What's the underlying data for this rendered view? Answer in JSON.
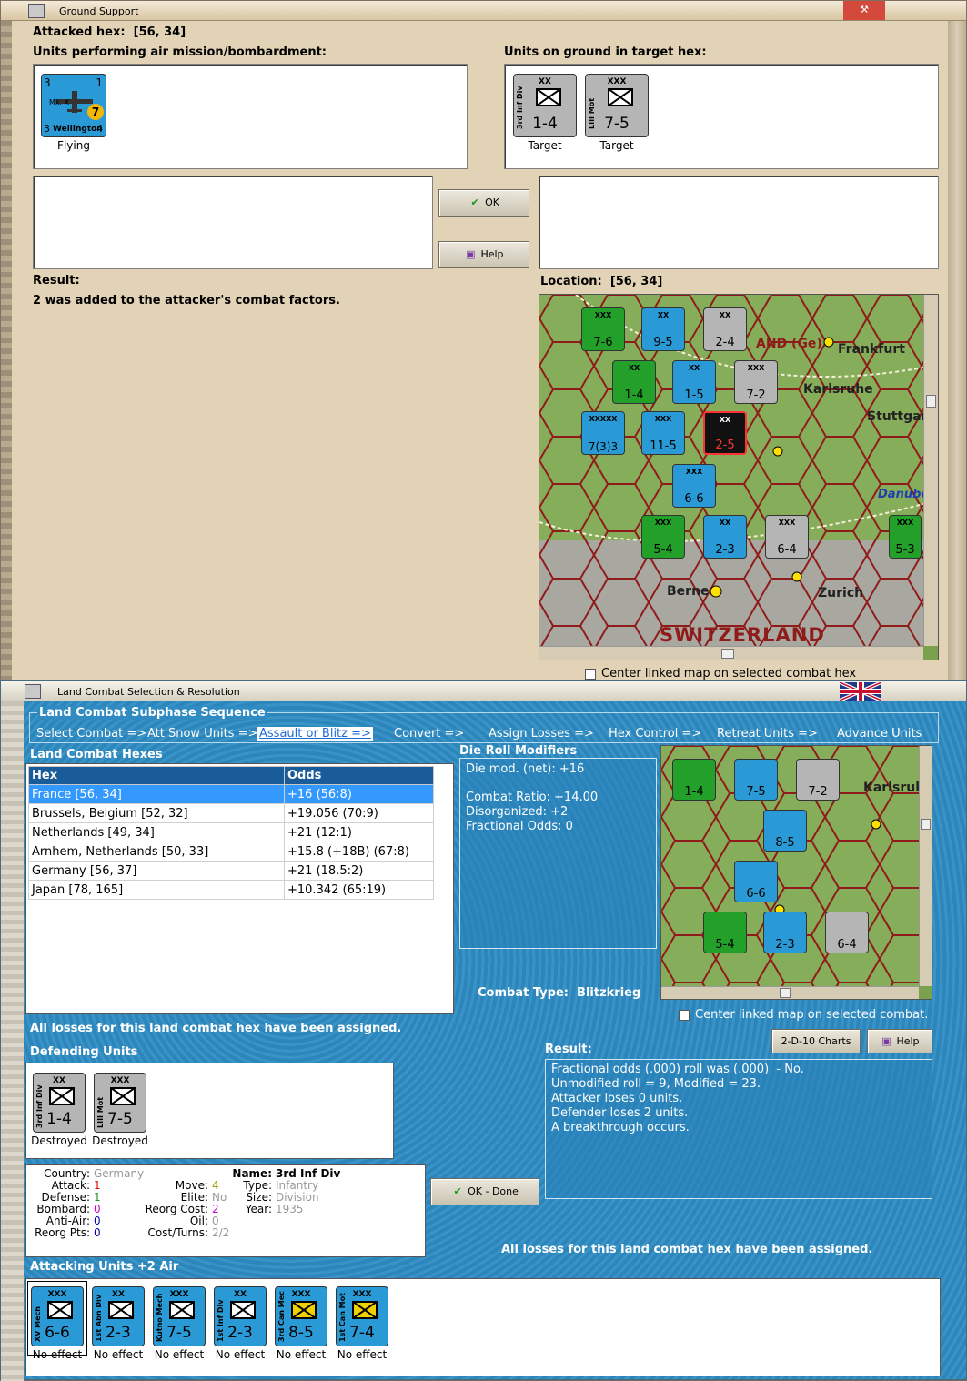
{
  "window1": {
    "title": "Ground Support",
    "attacked_hex_label": "Attacked hex:",
    "attacked_hex_value": "[56, 34]",
    "air_units_label": "Units performing air mission/bombardment:",
    "ground_units_label": "Units on ground in target hex:",
    "air_unit": {
      "id": "Mk. X",
      "name": "Wellington",
      "top_left": "3",
      "top_right": "1",
      "bottom_left": "3",
      "bottom_right": "4",
      "badge": "7",
      "status": "Flying"
    },
    "ground_units": [
      {
        "id": "3rd Inf Div",
        "size": "XX",
        "value": "1-4",
        "status": "Target"
      },
      {
        "id": "LIII Mot",
        "size": "XXX",
        "value": "7-5",
        "status": "Target"
      }
    ],
    "ok_label": "OK",
    "help_label": "Help",
    "result_label": "Result:",
    "result_text": "2 was added to the attacker's combat factors.",
    "location_label": "Location:",
    "location_value": "[56, 34]",
    "center_map_label": "Center linked map on selected combat hex",
    "map_labels": [
      "AND (Ge)",
      "Frankfurt",
      "Karlsruhe",
      "Stuttgar",
      "Danube",
      "Berne",
      "Zurich",
      "SWITZERLAND"
    ],
    "map_counters": [
      {
        "size": "XXX",
        "value": "7-6",
        "color": "green"
      },
      {
        "size": "XX",
        "value": "9-5",
        "color": "blue"
      },
      {
        "size": "XX",
        "value": "2-4",
        "color": "grey"
      },
      {
        "size": "XX",
        "value": "1-4",
        "color": "green"
      },
      {
        "size": "XX",
        "value": "1-5",
        "color": "blue"
      },
      {
        "size": "XXX",
        "value": "7-2",
        "color": "grey"
      },
      {
        "size": "XXXXX",
        "value": "7(3)3",
        "color": "blue"
      },
      {
        "size": "XXX",
        "value": "11-5",
        "color": "blue"
      },
      {
        "size": "XX",
        "value": "2-5",
        "color": "black"
      },
      {
        "size": "XXX",
        "value": "6-6",
        "color": "blue"
      },
      {
        "size": "XXX",
        "value": "5-4",
        "color": "green"
      },
      {
        "size": "XX",
        "value": "2-3",
        "color": "blue"
      },
      {
        "size": "XXX",
        "value": "6-4",
        "color": "grey"
      },
      {
        "size": "XXX",
        "value": "5-3",
        "color": "green"
      }
    ]
  },
  "window2": {
    "title": "Land Combat Selection & Resolution",
    "sequence_title": "Land Combat Subphase Sequence",
    "sequence": [
      {
        "label": "Select Combat =>",
        "active": false
      },
      {
        "label": "Att Snow Units =>",
        "active": false
      },
      {
        "label": "Assault or Blitz =>",
        "active": true
      },
      {
        "label": "Convert =>",
        "active": false
      },
      {
        "label": "Assign Losses =>",
        "active": false
      },
      {
        "label": "Hex Control =>",
        "active": false
      },
      {
        "label": "Retreat Units =>",
        "active": false
      },
      {
        "label": "Advance Units",
        "active": false
      }
    ],
    "hexes_label": "Land Combat Hexes",
    "table_headers": [
      "Hex",
      "Odds"
    ],
    "table_rows": [
      [
        "France [56, 34]",
        "+16 (56:8)"
      ],
      [
        "Brussels, Belgium [52, 32]",
        "+19.056 (70:9)"
      ],
      [
        "Netherlands [49, 34]",
        "+21 (12:1)"
      ],
      [
        "Arnhem, Netherlands [50, 33]",
        "+15.8 (+18B) (67:8)"
      ],
      [
        "Germany [56, 37]",
        "+21 (18.5:2)"
      ],
      [
        "Japan [78, 165]",
        "+10.342 (65:19)"
      ]
    ],
    "die_roll_label": "Die Roll Modifiers",
    "die_mod": "Die mod. (net): +16",
    "combat_ratio": "Combat Ratio: +14.00",
    "disorganized": "Disorganized: +2",
    "fractional_odds": "Fractional Odds: 0",
    "combat_type_label": "Combat Type:",
    "combat_type_value": "Blitzkrieg",
    "center_map_label": "Center linked map on selected combat.",
    "losses_assigned": "All losses for this land combat hex have been assigned.",
    "charts_label": "2-D-10 Charts",
    "help_label": "Help",
    "defending_label": "Defending Units",
    "defenders": [
      {
        "id": "3rd Inf Div",
        "size": "XX",
        "value": "1-4",
        "status": "Destroyed"
      },
      {
        "id": "LIII Mot",
        "size": "XXX",
        "value": "7-5",
        "status": "Destroyed"
      }
    ],
    "result_label": "Result:",
    "result_lines": [
      "Fractional odds (.000) roll was (.000)  - No.",
      "Unmodified roll = 9, Modified = 23.",
      "Attacker loses 0 units.",
      "Defender loses 2 units.",
      "A breakthrough occurs."
    ],
    "unit_info": {
      "country_label": "Country:",
      "country": "Germany",
      "attack_label": "Attack:",
      "attack": "1",
      "defense_label": "Defense:",
      "defense": "1",
      "bombard_label": "Bombard:",
      "bombard": "0",
      "antiair_label": "Anti-Air:",
      "antiair": "0",
      "reorgpts_label": "Reorg Pts:",
      "reorgpts": "0",
      "move_label": "Move:",
      "move": "4",
      "elite_label": "Elite:",
      "elite": "No",
      "reorgcost_label": "Reorg Cost:",
      "reorgcost": "2",
      "oil_label": "Oil:",
      "oil": "0",
      "costturns_label": "Cost/Turns:",
      "costturns": "2/2",
      "name_label": "Name:",
      "name": "3rd Inf Div",
      "type_label": "Type:",
      "type": "Infantry",
      "size_label": "Size:",
      "size": "Division",
      "year_label": "Year:",
      "year": "1935"
    },
    "ok_done_label": "OK - Done",
    "losses_assigned_2": "All losses for this land combat hex have been assigned.",
    "attacking_label": "Attacking Units +2 Air",
    "attackers": [
      {
        "id": "XV Mech",
        "size": "XXX",
        "value": "6-6",
        "status": "No effect",
        "color": "blue"
      },
      {
        "id": "1st Abn Div",
        "size": "XX",
        "value": "2-3",
        "status": "No effect",
        "color": "blue"
      },
      {
        "id": "Kutno Mech",
        "size": "XXX",
        "value": "7-5",
        "status": "No effect",
        "color": "blue"
      },
      {
        "id": "1st Inf Div",
        "size": "XX",
        "value": "2-3",
        "status": "No effect",
        "color": "blue"
      },
      {
        "id": "3rd Can Mech",
        "size": "XXX",
        "value": "8-5",
        "status": "No effect",
        "color": "yellow"
      },
      {
        "id": "1st Can Mot",
        "size": "XXX",
        "value": "7-4",
        "status": "No effect",
        "color": "yellow"
      }
    ],
    "map2_labels": [
      "Karlsrul"
    ],
    "map2_counters": [
      {
        "value": "1-4",
        "color": "green"
      },
      {
        "value": "7-5",
        "color": "blue"
      },
      {
        "value": "7-2",
        "color": "grey"
      },
      {
        "value": "8-5",
        "color": "blue"
      },
      {
        "value": "6-6",
        "color": "blue"
      },
      {
        "value": "5-4",
        "color": "green"
      },
      {
        "value": "2-3",
        "color": "blue"
      },
      {
        "value": "6-4",
        "color": "grey"
      }
    ]
  }
}
